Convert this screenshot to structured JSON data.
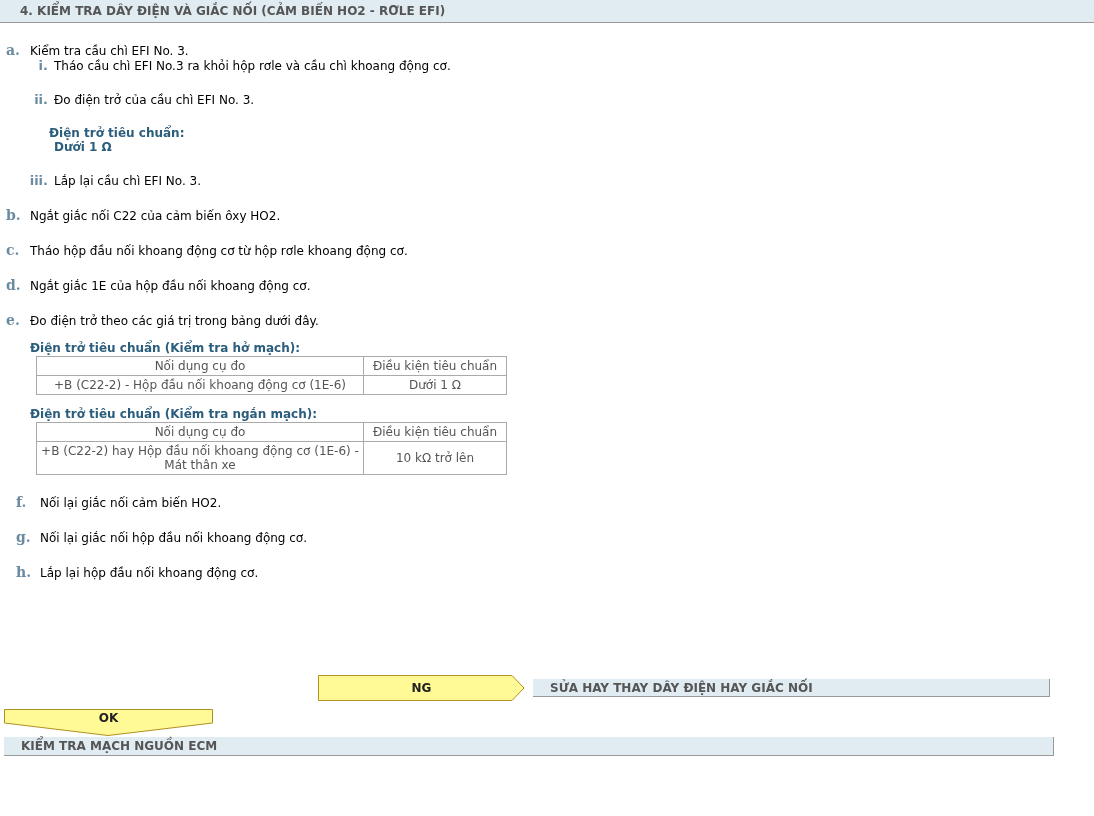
{
  "header": {
    "title": "4. KIỂM TRA DÂY ĐIỆN VÀ GIẮC NỐI (CẢM BIẾN HO2 - RƠLE EFI)"
  },
  "steps": [
    {
      "letter": "a.",
      "text": "Kiểm tra cầu chì EFI No. 3.",
      "substeps": [
        {
          "numeral": "i.",
          "text": "Tháo cầu chì EFI No.3 ra khỏi hộp rơle và cầu chì khoang động cơ."
        },
        {
          "numeral": "ii.",
          "text": "Đo điện trở của cầu chì EFI No. 3.",
          "spec": {
            "label": "Điện trở tiêu chuẩn:",
            "value": "Dưới 1 Ω"
          }
        },
        {
          "numeral": "iii.",
          "text": "Lắp lại cầu chì EFI No. 3."
        }
      ]
    },
    {
      "letter": "b.",
      "text": "Ngắt giắc nối C22 của cảm biến ôxy HO2."
    },
    {
      "letter": "c.",
      "text": "Tháo hộp đầu nối khoang động cơ từ hộp rơle khoang động cơ."
    },
    {
      "letter": "d.",
      "text": "Ngắt giắc 1E của hộp đầu nối khoang động cơ."
    },
    {
      "letter": "e.",
      "text": "Đo điện trở theo các giá trị trong bảng dưới đây.",
      "tables": [
        {
          "title": "Điện trở tiêu chuẩn (Kiểm tra hở mạch):",
          "columns": [
            "Nối dụng cụ đo",
            "Điều kiện tiêu chuẩn"
          ],
          "rows": [
            [
              "+B (C22-2) - Hộp đầu nối khoang động cơ (1E-6)",
              "Dưới 1 Ω"
            ]
          ]
        },
        {
          "title": "Điện trở tiêu chuẩn (Kiểm tra ngắn mạch):",
          "columns": [
            "Nối dụng cụ đo",
            "Điều kiện tiêu chuẩn"
          ],
          "rows": [
            [
              "+B (C22-2) hay Hộp đầu nối khoang động cơ (1E-6) - Mát thân xe",
              "10 kΩ trở lên"
            ]
          ]
        }
      ]
    },
    {
      "letter": "f.",
      "text": "Nối lại giắc nối cảm biến HO2."
    },
    {
      "letter": "g.",
      "text": "Nối lại giắc nối hộp đầu nối khoang động cơ."
    },
    {
      "letter": "h.",
      "text": "Lắp lại hộp đầu nối khoang động cơ."
    }
  ],
  "results": [
    {
      "kind": "ng",
      "label": "NG",
      "action": "SỬA HAY THAY DÂY ĐIỆN HAY GIẮC NỐI"
    },
    {
      "kind": "ok",
      "label": "OK",
      "action": "KIỂM TRA MẠCH NGUỒN ECM"
    }
  ]
}
